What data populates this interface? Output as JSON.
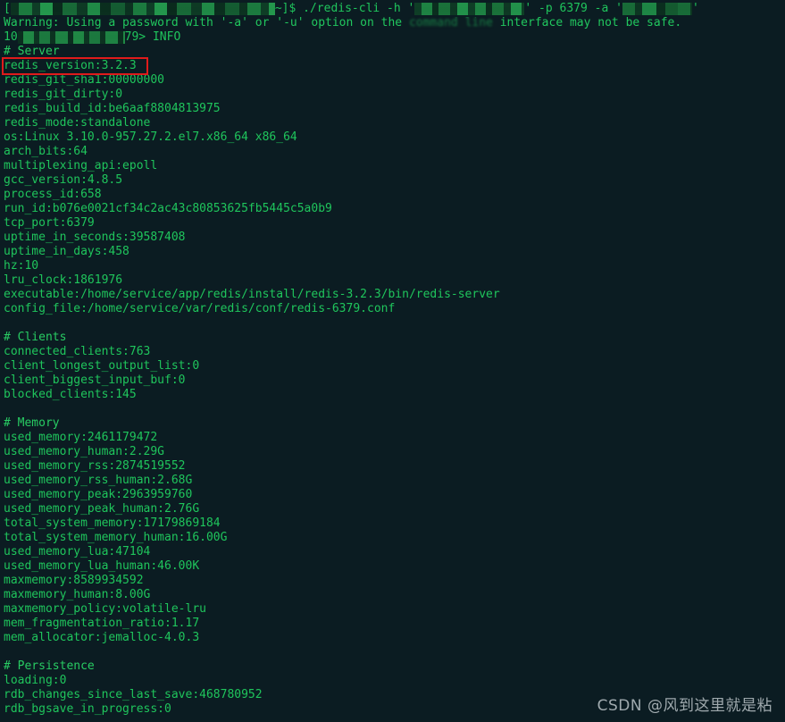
{
  "terminal": {
    "background_color": "#0b1c22",
    "text_color": "#1fc55c",
    "highlight_color": "#e01b1b",
    "watermark_color": "#b9c2c6",
    "prompt": {
      "open_bracket": "[",
      "user_host_redacted": "",
      "tail": "~]$ ",
      "command_head": "./redis-cli -h '",
      "host_redacted": "",
      "command_mid": "' -p 6379 -a '",
      "password_redacted": "",
      "command_tail": "'"
    },
    "warning": {
      "part1": "Warning: Using a password with '-a' or '-u' option on the ",
      "blurred": "command line",
      "part2": " interface may not be safe."
    },
    "redis_prompt": {
      "prefix": "10",
      "ip_redacted": "",
      "suffix": "79> ",
      "command": "INFO"
    },
    "sections": [
      {
        "header": "# Server",
        "lines": [
          "redis_version:3.2.3",
          "redis_git_sha1:00000000",
          "redis_git_dirty:0",
          "redis_build_id:be6aaf8804813975",
          "redis_mode:standalone",
          "os:Linux 3.10.0-957.27.2.el7.x86_64 x86_64",
          "arch_bits:64",
          "multiplexing_api:epoll",
          "gcc_version:4.8.5",
          "process_id:658",
          "run_id:b076e0021cf34c2ac43c80853625fb5445c5a0b9",
          "tcp_port:6379",
          "uptime_in_seconds:39587408",
          "uptime_in_days:458",
          "hz:10",
          "lru_clock:1861976",
          "executable:/home/service/app/redis/install/redis-3.2.3/bin/redis-server",
          "config_file:/home/service/var/redis/conf/redis-6379.conf"
        ]
      },
      {
        "header": "# Clients",
        "lines": [
          "connected_clients:763",
          "client_longest_output_list:0",
          "client_biggest_input_buf:0",
          "blocked_clients:145"
        ]
      },
      {
        "header": "# Memory",
        "lines": [
          "used_memory:2461179472",
          "used_memory_human:2.29G",
          "used_memory_rss:2874519552",
          "used_memory_rss_human:2.68G",
          "used_memory_peak:2963959760",
          "used_memory_peak_human:2.76G",
          "total_system_memory:17179869184",
          "total_system_memory_human:16.00G",
          "used_memory_lua:47104",
          "used_memory_lua_human:46.00K",
          "maxmemory:8589934592",
          "maxmemory_human:8.00G",
          "maxmemory_policy:volatile-lru",
          "mem_fragmentation_ratio:1.17",
          "mem_allocator:jemalloc-4.0.3"
        ]
      },
      {
        "header": "# Persistence",
        "lines": [
          "loading:0",
          "rdb_changes_since_last_save:468780952",
          "rdb_bgsave_in_progress:0"
        ]
      }
    ],
    "highlighted_line": "redis_version:3.2.3",
    "watermark": "CSDN @风到这里就是粘"
  }
}
